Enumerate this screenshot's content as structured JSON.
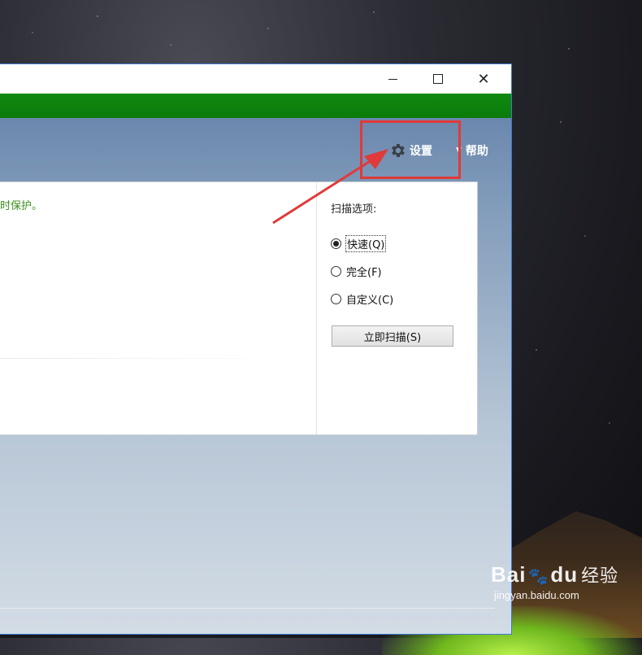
{
  "window": {
    "controls": {
      "minimize": "",
      "maximize": "",
      "close": "✕"
    }
  },
  "toolbar": {
    "settings_label": "设置",
    "help_label": "帮助",
    "help_caret": "▼"
  },
  "status": {
    "text": "时保护。"
  },
  "scan_options": {
    "title": "扫描选项:",
    "options": [
      {
        "label": "快速(Q)",
        "checked": true
      },
      {
        "label": "完全(F)",
        "checked": false
      },
      {
        "label": "自定义(C)",
        "checked": false
      }
    ],
    "scan_button": "立即扫描(S)"
  },
  "annotation": {
    "color": "#e03a3a"
  },
  "watermark": {
    "brand": "Bai",
    "brand_suffix": "du",
    "product": "经验",
    "url": "jingyan.baidu.com"
  },
  "colors": {
    "status_green": "#3f8f1f",
    "header_green": "#0a7a0a",
    "highlight_red": "#e03a3a"
  }
}
